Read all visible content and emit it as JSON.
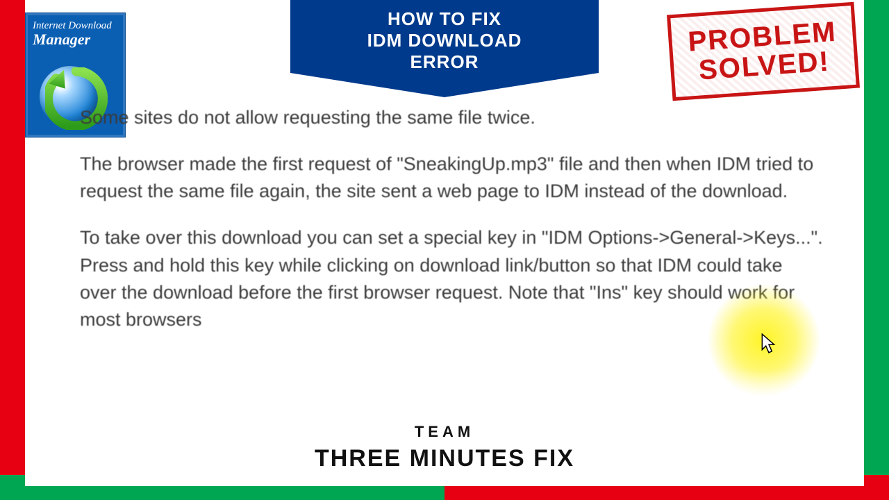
{
  "banner": {
    "line1": "HOW TO FIX",
    "line2": "IDM DOWNLOAD",
    "line3": "ERROR"
  },
  "idm_box": {
    "line1": "Internet Download",
    "line2": "Manager"
  },
  "stamp": {
    "line1": "PROBLEM",
    "line2": "SOLVED!"
  },
  "message": {
    "p1": "Some sites do not allow requesting the same file twice.",
    "p2": "The browser made the first request of \"SneakingUp.mp3\" file and then when IDM tried to request the same file again, the site sent a web page to IDM instead of the download.",
    "p3": "To take over this download you can set a special key in \"IDM Options->General->Keys...\". Press and hold this key while clicking on download link/button so that IDM could take over the download before the first browser request. Note that \"Ins\" key should work for most browsers"
  },
  "team": {
    "line1": "TEAM",
    "line2": "THREE MINUTES FIX"
  },
  "colors": {
    "red": "#e60012",
    "green": "#00a651",
    "blue": "#003a8c",
    "stamp_red": "#c81414"
  }
}
